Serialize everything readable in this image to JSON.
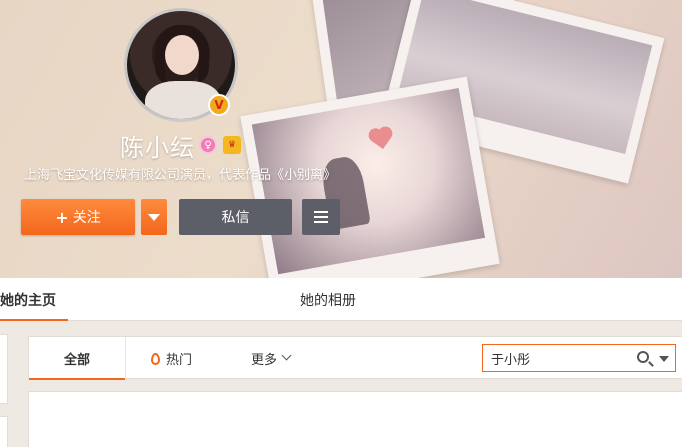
{
  "profile": {
    "name": "陈小纭",
    "bio": "上海飞宝文化传媒有限公司演员，代表作品《小别离》",
    "verified_badge": "V",
    "gender_icon": "female-icon",
    "member_icon": "vip-member-icon"
  },
  "actions": {
    "follow_label": "关注",
    "message_label": "私信"
  },
  "nav": {
    "tabs": [
      {
        "label": "她的主页",
        "active": true
      },
      {
        "label": "她的相册",
        "active": false
      }
    ]
  },
  "feed": {
    "tabs": [
      {
        "label": "全部",
        "active": true
      },
      {
        "label": "热门"
      },
      {
        "label": "更多"
      }
    ],
    "search": {
      "value": "于小彤"
    }
  },
  "colors": {
    "accent": "#f2671c",
    "dark_button": "#5d5f68"
  }
}
